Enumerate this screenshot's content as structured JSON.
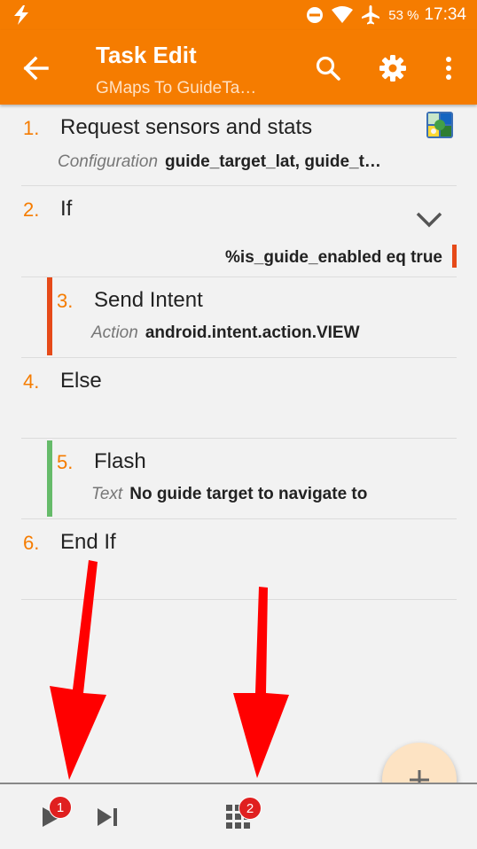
{
  "status_bar": {
    "battery_percent": "53 %",
    "time": "17:34",
    "icons": [
      "bolt-icon",
      "do-not-disturb-icon",
      "wifi-icon",
      "airplane-icon"
    ]
  },
  "app_bar": {
    "title": "Task Edit",
    "subtitle": "GMaps To GuideTa…",
    "icons": [
      "back-arrow-icon",
      "search-icon",
      "gear-icon",
      "more-vert-icon"
    ]
  },
  "actions": [
    {
      "number": "1.",
      "name": "Request sensors and stats",
      "param_key": "Configuration",
      "param_value": "guide_target_lat, guide_t…",
      "icon": "app-icon"
    },
    {
      "number": "2.",
      "name": "If",
      "condition": "%is_guide_enabled eq true",
      "icon": "chevron-down-icon"
    },
    {
      "number": "3.",
      "name": "Send Intent",
      "param_key": "Action",
      "param_value": "android.intent.action.VIEW"
    },
    {
      "number": "4.",
      "name": "Else"
    },
    {
      "number": "5.",
      "name": "Flash",
      "param_key": "Text",
      "param_value": "No guide target to navigate to"
    },
    {
      "number": "6.",
      "name": "End If"
    }
  ],
  "bottom_bar": {
    "play_badge": "1",
    "grid_badge": "2",
    "icons": [
      "play-icon",
      "step-to-end-icon",
      "grid-icon"
    ]
  },
  "fab": {
    "icon": "plus-icon"
  },
  "colors": {
    "accent": "#f57c00",
    "if_bar": "#e64a19",
    "else_bar": "#66bb6a",
    "arrow": "#ff0000"
  }
}
